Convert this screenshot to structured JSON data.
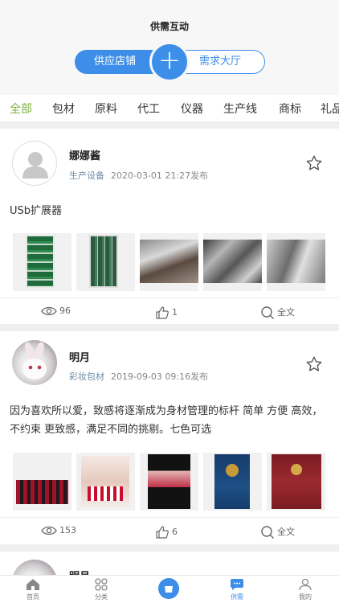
{
  "header": {
    "title": "供需互动",
    "segment_left": "供应店铺",
    "segment_right": "需求大厅",
    "plus": "+"
  },
  "tabs": [
    "全部",
    "包材",
    "原料",
    "代工",
    "仪器",
    "生产线",
    "商标",
    "礼品"
  ],
  "active_tab": "全部",
  "posts": [
    {
      "user": "娜娜酱",
      "category": "生产设备",
      "datetime": "2020-03-01 21:27发布",
      "text": "USb扩展器",
      "views": "96",
      "likes": "1",
      "fulltext": "全文"
    },
    {
      "user": "明月",
      "category": "彩妆包材",
      "datetime": "2019-09-03 09:16发布",
      "text": "因为喜欢所以爱，致感将逐渐成为身材管理的标杆 简单 方便 高效，不约束 更致感，满足不同的挑剔。七色可选",
      "views": "153",
      "likes": "6",
      "fulltext": "全文"
    },
    {
      "user": "明月"
    }
  ],
  "bottom_nav": [
    {
      "label": "首页",
      "icon": "home-icon"
    },
    {
      "label": "分类",
      "icon": "category-icon"
    },
    {
      "label": "",
      "icon": "center-icon"
    },
    {
      "label": "供需",
      "icon": "chat-icon"
    },
    {
      "label": "我的",
      "icon": "user-icon"
    }
  ],
  "colors": {
    "accent": "#3c8ee8",
    "tab_active": "#7cb342"
  }
}
